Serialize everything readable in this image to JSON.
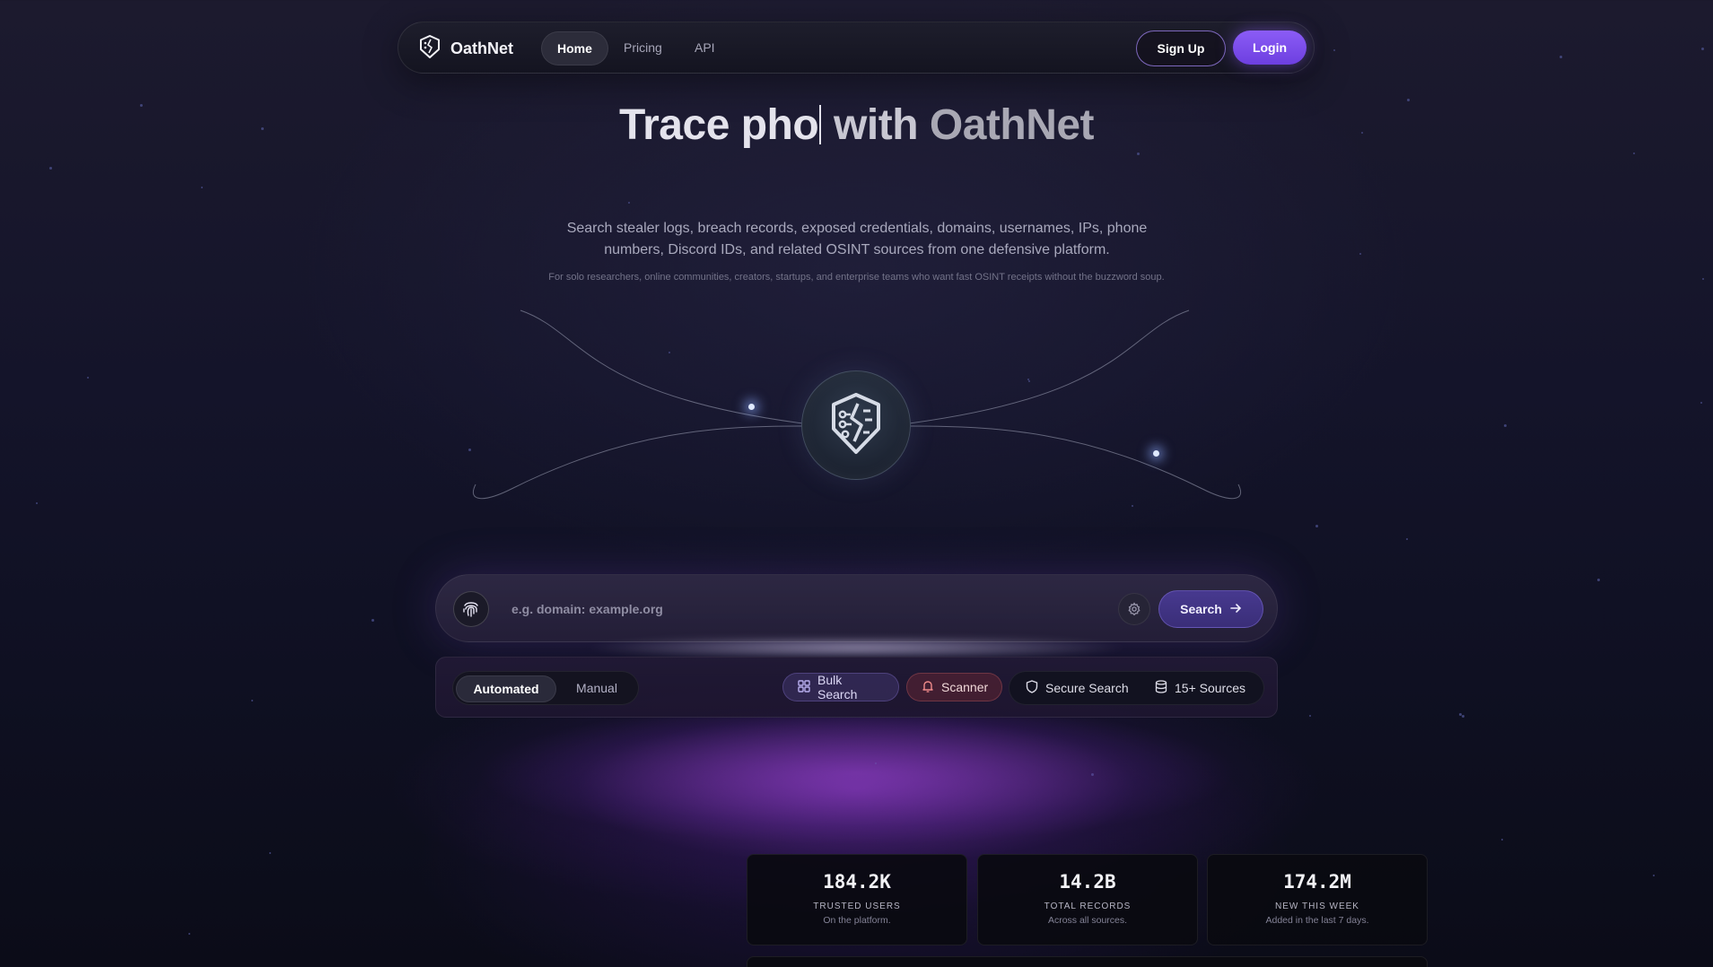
{
  "nav": {
    "brand": "OathNet",
    "links": [
      {
        "label": "Home",
        "active": true
      },
      {
        "label": "Pricing",
        "active": false
      },
      {
        "label": "API",
        "active": false
      }
    ],
    "signup_label": "Sign Up",
    "login_label": "Login"
  },
  "hero": {
    "title_typed": "Trace pho",
    "title_with": "with",
    "title_brand": "OathNet",
    "subtitle": "Search stealer logs, breach records, exposed credentials, domains, usernames, IPs, phone numbers, Discord IDs, and related OSINT sources from one defensive platform.",
    "tagline": "For solo researchers, online communities, creators, startups, and enterprise teams who want fast OSINT receipts without the buzzword soup."
  },
  "search": {
    "placeholder": "e.g. domain: example.org",
    "value": "",
    "button_label": "Search"
  },
  "toolbar": {
    "modes": [
      {
        "label": "Automated",
        "active": true
      },
      {
        "label": "Manual",
        "active": false
      }
    ],
    "bulk_label": "Bulk Search",
    "scanner_label": "Scanner",
    "secure_label": "Secure Search",
    "sources_label": "15+ Sources"
  },
  "stats": [
    {
      "value": "184.2K",
      "label": "TRUSTED USERS",
      "desc": "On the platform."
    },
    {
      "value": "14.2B",
      "label": "TOTAL RECORDS",
      "desc": "Across all sources."
    },
    {
      "value": "174.2M",
      "label": "NEW THIS WEEK",
      "desc": "Added in the last 7 days."
    }
  ],
  "colors": {
    "accent": "#7c4dff",
    "background": "#14142a"
  }
}
